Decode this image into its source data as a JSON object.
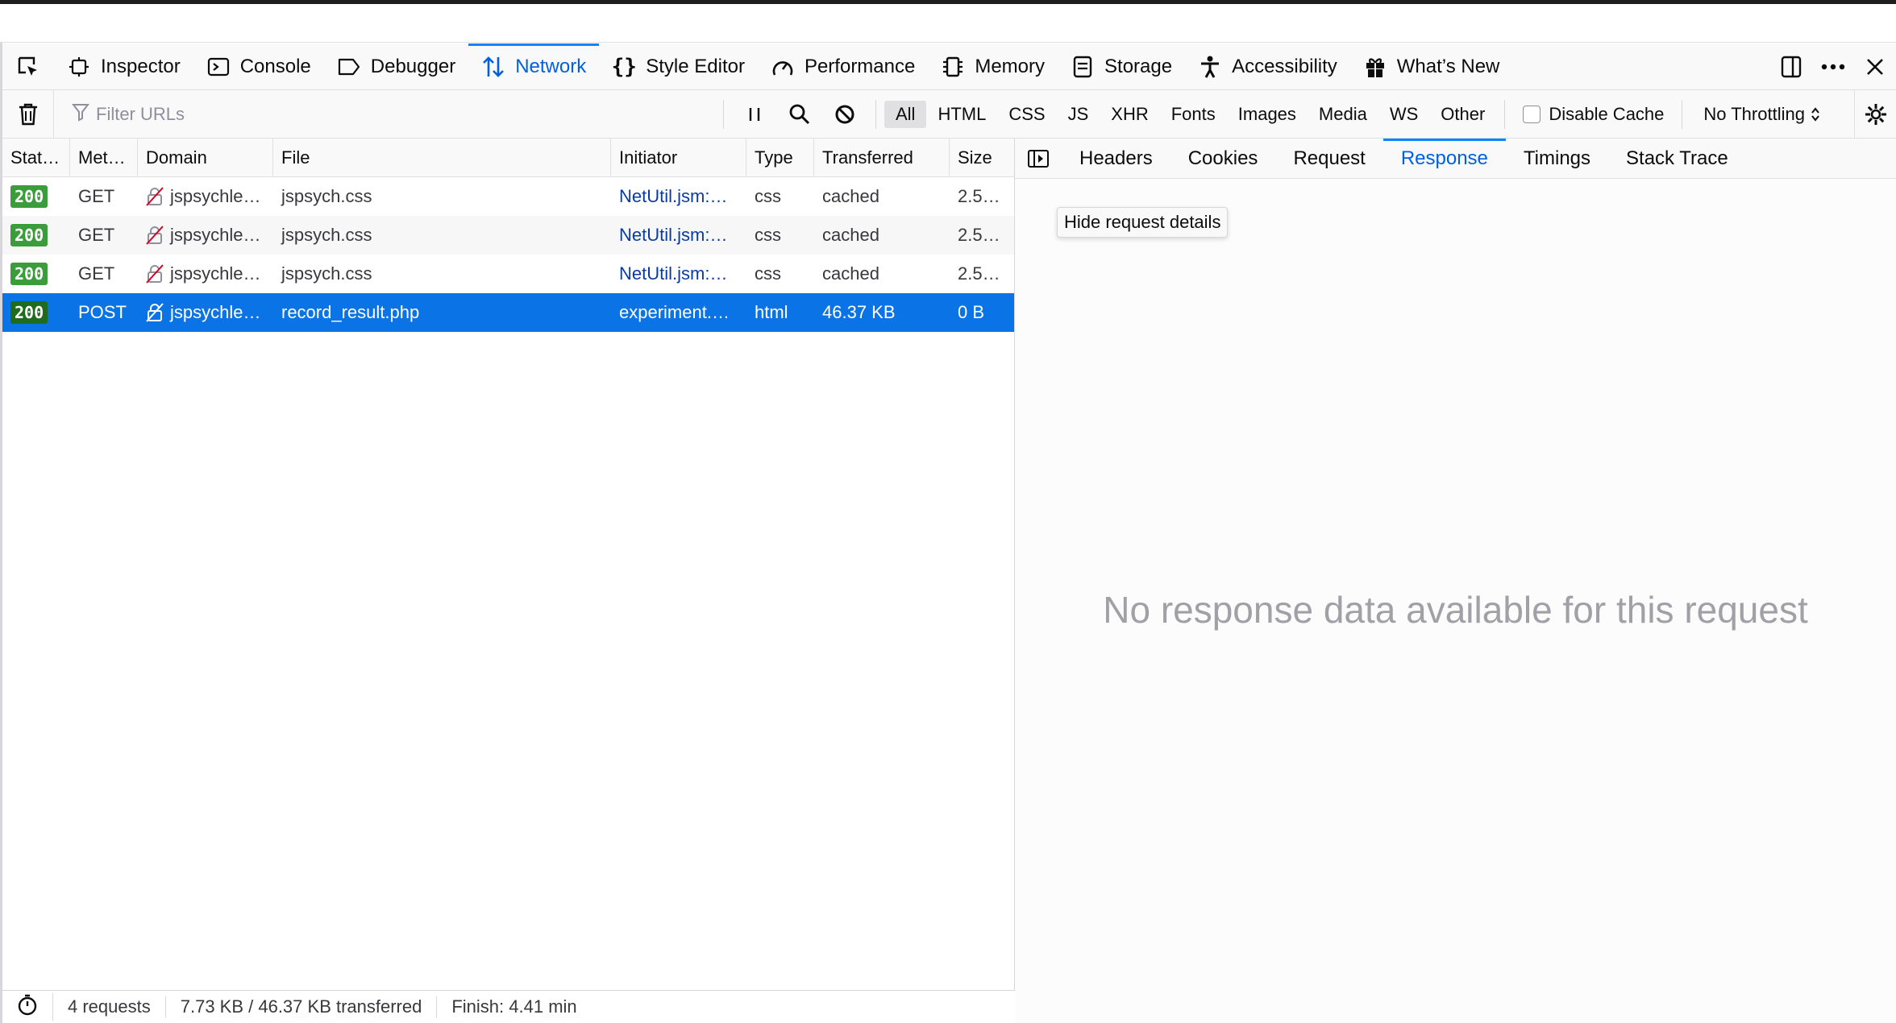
{
  "toolbox": {
    "tabs": [
      {
        "label": "Inspector",
        "icon": "inspector-icon"
      },
      {
        "label": "Console",
        "icon": "console-icon"
      },
      {
        "label": "Debugger",
        "icon": "debugger-icon"
      },
      {
        "label": "Network",
        "icon": "network-icon",
        "active": true
      },
      {
        "label": "Style Editor",
        "icon": "style-editor-icon"
      },
      {
        "label": "Performance",
        "icon": "performance-icon"
      },
      {
        "label": "Memory",
        "icon": "memory-icon"
      },
      {
        "label": "Storage",
        "icon": "storage-icon"
      },
      {
        "label": "Accessibility",
        "icon": "accessibility-icon"
      },
      {
        "label": "What’s New",
        "icon": "gift-icon"
      }
    ]
  },
  "filterbar": {
    "placeholder": "Filter URLs",
    "types": [
      "All",
      "HTML",
      "CSS",
      "JS",
      "XHR",
      "Fonts",
      "Images",
      "Media",
      "WS",
      "Other"
    ],
    "active_type": "All",
    "disable_cache_label": "Disable Cache",
    "throttle_label": "No Throttling"
  },
  "table": {
    "headers": [
      "Stat…",
      "Met…",
      "Domain",
      "File",
      "Initiator",
      "Type",
      "Transferred",
      "Size"
    ],
    "rows": [
      {
        "status": "200",
        "method": "GET",
        "domain": "jspsychle…",
        "file": "jspsych.css",
        "initiator": "NetUtil.jsm:…",
        "type": "css",
        "transferred": "cached",
        "size": "2.5…"
      },
      {
        "status": "200",
        "method": "GET",
        "domain": "jspsychle…",
        "file": "jspsych.css",
        "initiator": "NetUtil.jsm:…",
        "type": "css",
        "transferred": "cached",
        "size": "2.5…"
      },
      {
        "status": "200",
        "method": "GET",
        "domain": "jspsychle…",
        "file": "jspsych.css",
        "initiator": "NetUtil.jsm:…",
        "type": "css",
        "transferred": "cached",
        "size": "2.5…"
      },
      {
        "status": "200",
        "method": "POST",
        "domain": "jspsychle…",
        "file": "record_result.php",
        "initiator": "experiment.…",
        "type": "html",
        "transferred": "46.37 KB",
        "size": "0 B"
      }
    ],
    "selected_index": 3
  },
  "statusbar": {
    "requests": "4 requests",
    "transferred": "7.73 KB / 46.37 KB transferred",
    "finish": "Finish: 4.41 min"
  },
  "details": {
    "tabs": [
      "Headers",
      "Cookies",
      "Request",
      "Response",
      "Timings",
      "Stack Trace"
    ],
    "active_tab": "Response",
    "tooltip": "Hide request details",
    "empty_message": "No response data available for this request"
  },
  "colors": {
    "accent": "#0060df",
    "selected_row": "#0a74e6",
    "status_ok": "#3a9c3a"
  }
}
